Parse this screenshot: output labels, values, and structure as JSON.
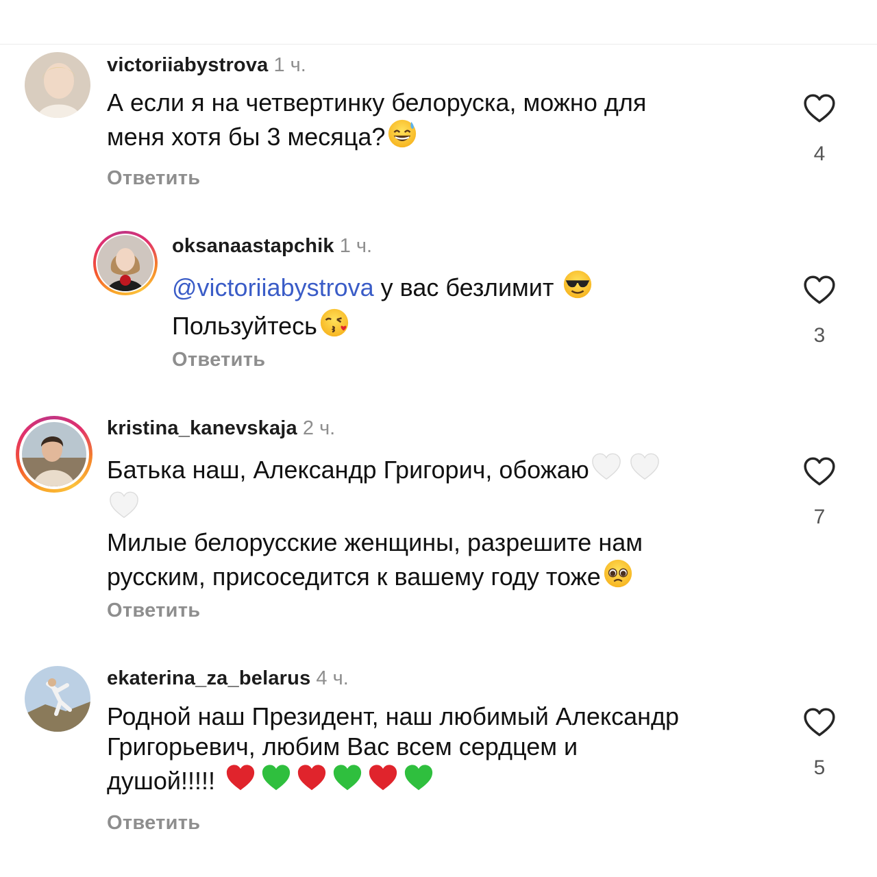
{
  "reply_label": "Ответить",
  "comments": [
    {
      "username": "victoriiabystrova",
      "time": "1 ч.",
      "line1": "А если я на четвертинку белоруска, можно для",
      "line2": "меня хотя бы 3 месяца?",
      "emoji": "grinning-sweat",
      "likes": "4"
    },
    {
      "username": "oksanaastapchik",
      "time": "1 ч.",
      "mention": "@victoriiabystrova",
      "line1_rest": " у вас безлимит ",
      "line2": "Пользуйтесь",
      "emoji": [
        "sunglasses-face",
        "kissing-heart-face"
      ],
      "likes": "3"
    },
    {
      "username": "kristina_kanevskaja",
      "time": "2 ч.",
      "line1": "Батька наш, Александр Григорич, обожаю",
      "line3": "Милые белорусские женщины, разрешите нам",
      "line4": "русским, присоседится к вашему году тоже",
      "emoji": [
        "white-heart",
        "white-heart",
        "white-heart",
        "pleading-face"
      ],
      "likes": "7"
    },
    {
      "username": "ekaterina_za_belarus",
      "time": "4 ч.",
      "line1": "Родной наш Президент, наш любимый Александр",
      "line2": "Григорьевич, любим Вас всем сердцем и",
      "line3": "душой!!!!!",
      "emoji": [
        "red-heart",
        "green-heart",
        "red-heart",
        "green-heart",
        "red-heart",
        "green-heart"
      ],
      "likes": "5"
    }
  ],
  "colors": {
    "mention": "#3a5cc7",
    "muted": "#8e8e8e",
    "red_heart": "#e0242c",
    "green_heart": "#2fbf3e"
  }
}
